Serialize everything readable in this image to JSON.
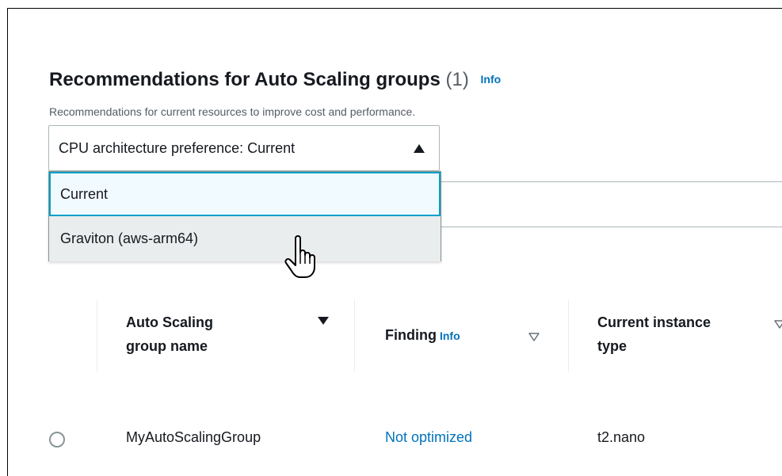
{
  "panel": {
    "title": "Recommendations for Auto Scaling groups",
    "count": "(1)",
    "info_label": "Info",
    "description": "Recommendations for current resources to improve cost and performance."
  },
  "select": {
    "label": "CPU architecture preference: Current",
    "options": [
      {
        "label": "Current",
        "selected": true
      },
      {
        "label": "Graviton (aws-arm64)",
        "hovered": true
      }
    ]
  },
  "table": {
    "columns": [
      {
        "label_line1": "Auto Scaling",
        "label_line2": "group name",
        "sort": "descending"
      },
      {
        "label": "Finding",
        "info_label": "Info",
        "sort": "unsorted"
      },
      {
        "label_line1": "Current instance",
        "label_line2": "type",
        "sort": "unsorted"
      }
    ],
    "rows": [
      {
        "name": "MyAutoScalingGroup",
        "finding": "Not optimized",
        "instance_type": "t2.nano"
      }
    ]
  },
  "colors": {
    "link": "#0073bb",
    "focus_border": "#00a1c9",
    "hover_bg": "#eaeded"
  },
  "icons": {
    "select_caret": "caret-up-icon",
    "pointer": "hand-pointer-icon"
  }
}
